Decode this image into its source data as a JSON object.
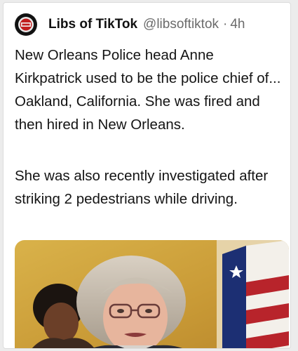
{
  "tweet": {
    "author_name": "Libs of TikTok",
    "handle": "@libsoftiktok",
    "separator": "·",
    "timestamp": "4h",
    "paragraphs": [
      "New Orleans Police head Anne Kirkpatrick used to be the police chief of... Oakland, California. She was fired and then hired in New Orleans.",
      "She was also recently investigated after striking 2 pedestrians while driving."
    ]
  },
  "media": {
    "kind": "photo",
    "icon": "photo-of-press-conference"
  },
  "colors": {
    "text": "#141414",
    "secondary": "#6b6b6b",
    "background": "#ffffff"
  }
}
